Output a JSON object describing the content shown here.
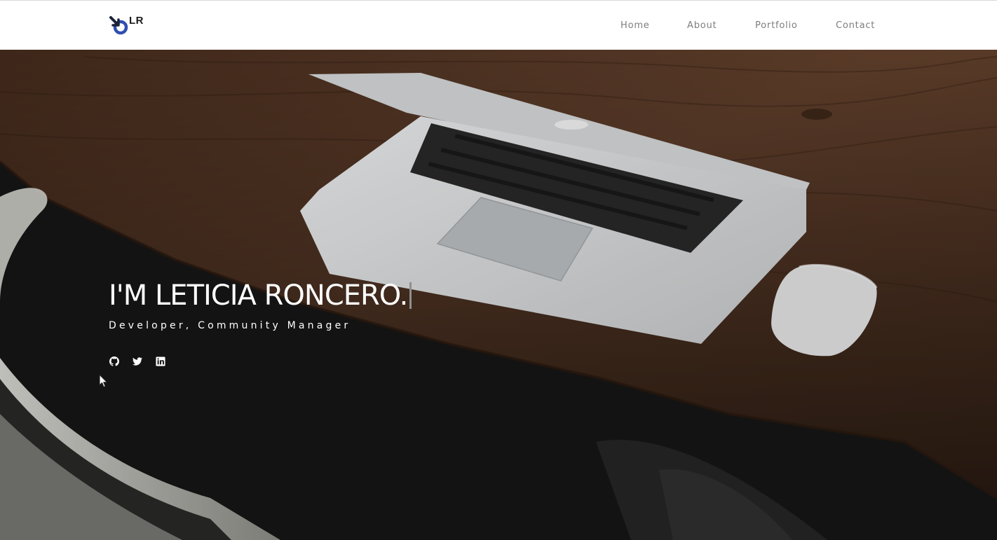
{
  "header": {
    "logo_text": "LR",
    "logo_icon": "lr-logo-icon"
  },
  "nav": {
    "items": [
      {
        "label": "Home"
      },
      {
        "label": "About"
      },
      {
        "label": "Portfolio"
      },
      {
        "label": "Contact"
      }
    ]
  },
  "hero": {
    "headline": "I'M LETICIA RONCERO.",
    "subtitle": "Developer, Community Manager",
    "social": [
      {
        "icon": "github-icon"
      },
      {
        "icon": "twitter-icon"
      },
      {
        "icon": "linkedin-icon"
      }
    ]
  },
  "colors": {
    "header_bg": "#ffffff",
    "nav_text": "#7d7d7d",
    "hero_text": "#ffffff",
    "logo_blue": "#2f4fb0",
    "logo_dark": "#1b2238"
  }
}
